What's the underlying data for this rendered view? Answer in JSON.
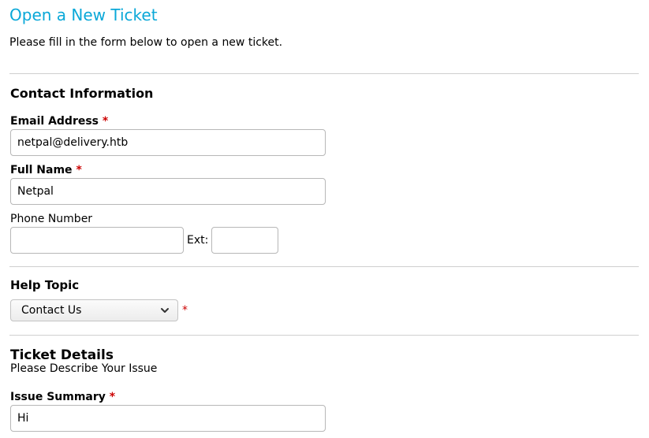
{
  "page": {
    "title": "Open a New Ticket",
    "intro": "Please fill in the form below to open a new ticket."
  },
  "contact": {
    "heading": "Contact Information",
    "email": {
      "label": "Email Address",
      "required_mark": "*",
      "value": "netpal@delivery.htb"
    },
    "full_name": {
      "label": "Full Name",
      "required_mark": "*",
      "value": "Netpal"
    },
    "phone": {
      "label": "Phone Number",
      "value": "",
      "ext_label": "Ext:",
      "ext_value": ""
    }
  },
  "help_topic": {
    "heading": "Help Topic",
    "selected": "Contact Us",
    "required_mark": "*"
  },
  "ticket_details": {
    "heading": "Ticket Details",
    "subtitle": "Please Describe Your Issue",
    "issue_summary": {
      "label": "Issue Summary",
      "required_mark": "*",
      "value": "Hi"
    }
  },
  "icons": {
    "select_arrow": "chevron-down-icon"
  },
  "colors": {
    "title": "#0aa8d8",
    "required": "#cc0000",
    "divider": "#cfcfcf"
  }
}
